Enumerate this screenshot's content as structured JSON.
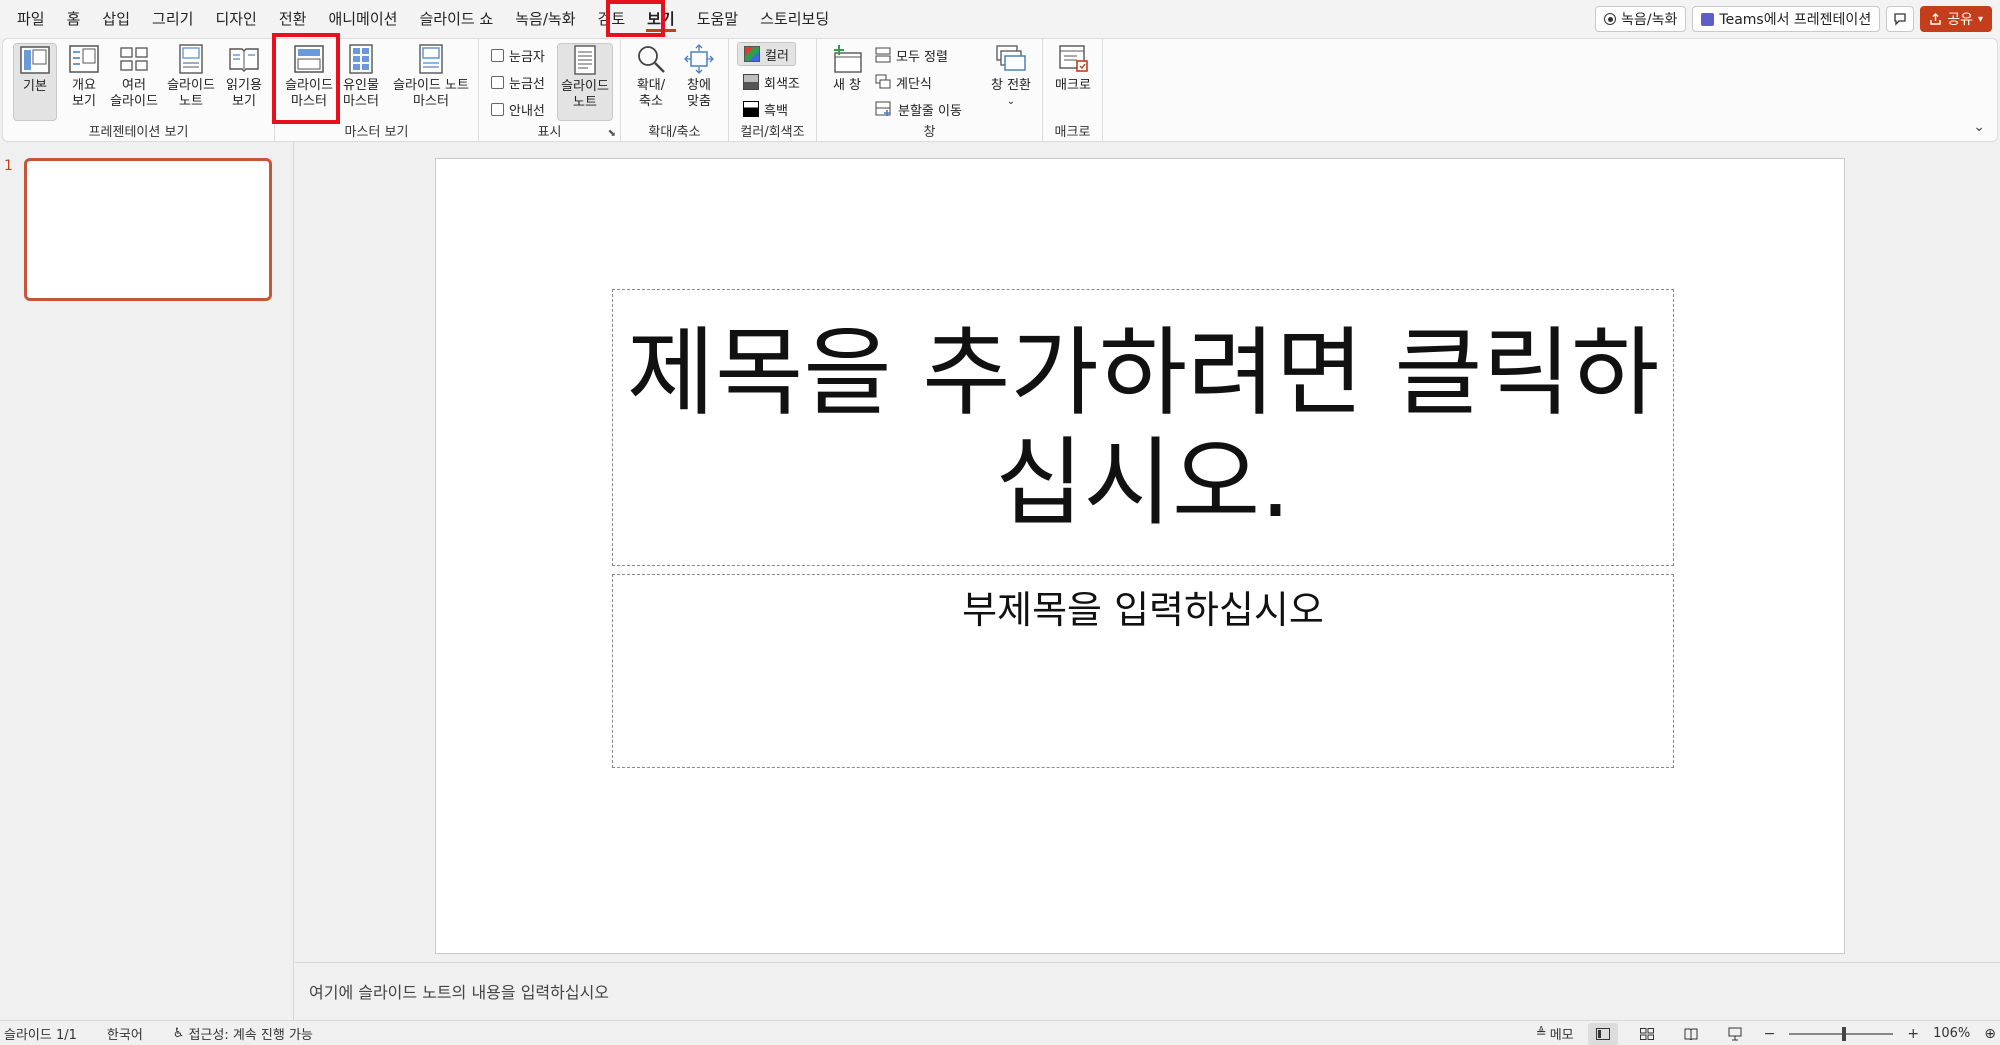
{
  "menu": {
    "tabs": [
      "파일",
      "홈",
      "삽입",
      "그리기",
      "디자인",
      "전환",
      "애니메이션",
      "슬라이드 쇼",
      "녹음/녹화",
      "검토",
      "보기",
      "도움말",
      "스토리보딩"
    ],
    "active_tab": "보기"
  },
  "top_right": {
    "record": "녹음/녹화",
    "teams": "Teams에서 프레젠테이션",
    "share": "공유"
  },
  "ribbon": {
    "presentation_views": {
      "label": "프레젠테이션 보기",
      "normal": "기본",
      "outline_1": "개요",
      "outline_2": "보기",
      "sorter_1": "여러",
      "sorter_2": "슬라이드",
      "notes_1": "슬라이드",
      "notes_2": "노트",
      "reading_1": "읽기용",
      "reading_2": "보기"
    },
    "master_views": {
      "label": "마스터 보기",
      "slide_master_1": "슬라이드",
      "slide_master_2": "마스터",
      "handout_master_1": "유인물",
      "handout_master_2": "마스터",
      "notes_master_1": "슬라이드 노트",
      "notes_master_2": "마스터"
    },
    "show": {
      "label": "표시",
      "ruler": "눈금자",
      "gridlines": "눈금선",
      "guides": "안내선",
      "notes_1": "슬라이드",
      "notes_2": "노트"
    },
    "zoom": {
      "label": "확대/축소",
      "zoom_1": "확대/",
      "zoom_2": "축소",
      "fit_1": "창에",
      "fit_2": "맞춤"
    },
    "color": {
      "label": "컬러/회색조",
      "color": "컬러",
      "grayscale": "회색조",
      "bw": "흑백"
    },
    "window": {
      "label": "창",
      "new_window": "새 창",
      "arrange_all": "모두 정렬",
      "cascade": "계단식",
      "move_split": "분할줄 이동",
      "switch_windows": "창 전환"
    },
    "macros": {
      "label": "매크로",
      "macros": "매크로"
    }
  },
  "thumbnails": {
    "number": "1"
  },
  "slide": {
    "title_line1": "제목을 추가하려면 클릭하",
    "title_line2": "십시오.",
    "subtitle": "부제목을 입력하십시오"
  },
  "notes": {
    "placeholder": "여기에 슬라이드 노트의 내용을 입력하십시오"
  },
  "status": {
    "slide": "슬라이드 1/1",
    "language": "한국어",
    "accessibility": "접근성: 계속 진행 가능",
    "memo": "메모",
    "zoom": "106%",
    "zoom_fraction": 0.53
  },
  "colors": {
    "accent": "#c43e1c",
    "highlight": "#e8101b"
  }
}
